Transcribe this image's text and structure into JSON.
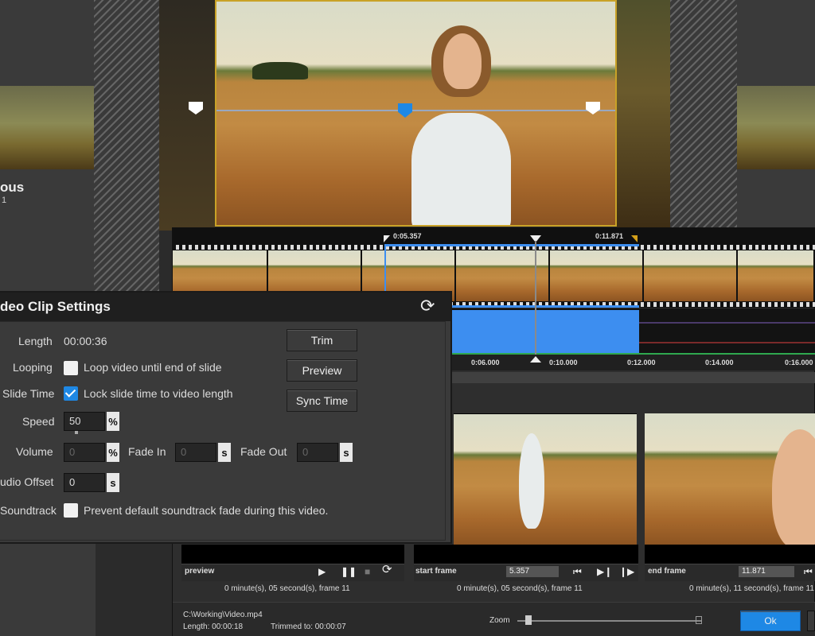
{
  "left_panel": {
    "title_fragment": "ous",
    "sub_fragment": "1"
  },
  "timeline": {
    "marker_start": "0:05.357",
    "marker_end": "0:11.871",
    "ticks": [
      "0:06.000",
      "0:10.000",
      "0:12.000",
      "0:14.000",
      "0:16.000"
    ]
  },
  "dialog": {
    "title": "deo Clip Settings",
    "rows": {
      "length_label": "Length",
      "length_value": "00:00:36",
      "looping_label": "Looping",
      "looping_text": "Loop video until end of slide",
      "slide_time_label": "Slide Time",
      "slide_time_text": "Lock slide time to video length",
      "speed_label": "Speed",
      "speed_value": "50",
      "volume_label": "Volume",
      "volume_value": "0",
      "fade_in_label": "Fade In",
      "fade_in_value": "0",
      "fade_out_label": "Fade Out",
      "fade_out_value": "0",
      "audio_offset_label": "udio Offset",
      "audio_offset_value": "0",
      "soundtrack_label": "Soundtrack",
      "soundtrack_text": "Prevent default soundtrack fade during this video."
    },
    "units": {
      "percent": "%",
      "seconds": "s"
    },
    "buttons": {
      "trim": "Trim",
      "preview": "Preview",
      "sync": "Sync Time"
    },
    "checks": {
      "looping": false,
      "slide_time": true,
      "soundtrack": false
    }
  },
  "panes": {
    "preview": {
      "label": "preview",
      "status": "0 minute(s), 05 second(s), frame 11"
    },
    "start": {
      "label": "start frame",
      "value": "5.357",
      "status": "0 minute(s), 05 second(s), frame 11"
    },
    "end": {
      "label": "end frame",
      "value": "11.871",
      "status": "0 minute(s), 11 second(s), frame 11"
    }
  },
  "footer": {
    "path": "C:\\Working\\Video.mp4",
    "length": "Length: 00:00:18",
    "trimmed": "Trimmed to: 00:00:07",
    "zoom_label": "Zoom",
    "ok": "Ok"
  },
  "colors": {
    "accent": "#1e88e5",
    "dialog_bg": "#3a3a3a",
    "selection": "#3d8ef0"
  }
}
